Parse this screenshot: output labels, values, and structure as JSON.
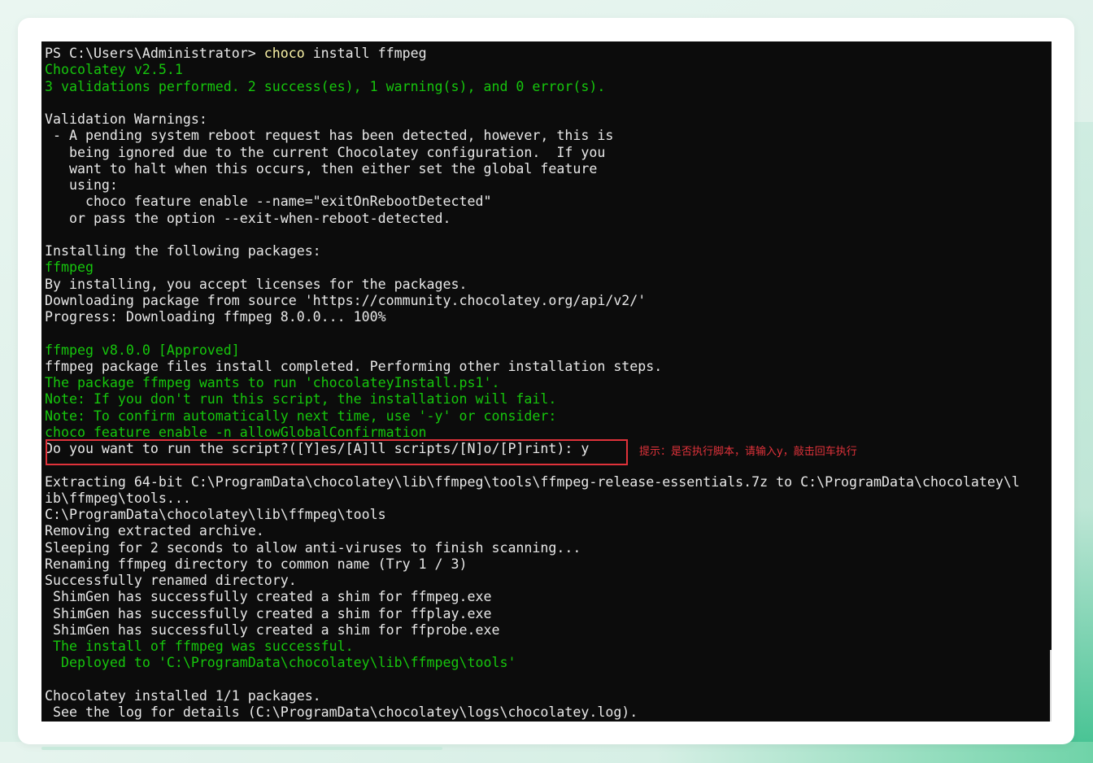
{
  "terminal": {
    "lines": [
      {
        "text": "PS C:\\Users\\Administrator> choco install ffmpeg",
        "color": "white"
      },
      {
        "text": "Chocolatey v2.5.1",
        "color": "green"
      },
      {
        "text": "3 validations performed. 2 success(es), 1 warning(s), and 0 error(s).",
        "color": "green"
      },
      {
        "text": "",
        "color": "white"
      },
      {
        "text": "Validation Warnings:",
        "color": "white"
      },
      {
        "text": " - A pending system reboot request has been detected, however, this is",
        "color": "white"
      },
      {
        "text": "   being ignored due to the current Chocolatey configuration.  If you",
        "color": "white"
      },
      {
        "text": "   want to halt when this occurs, then either set the global feature",
        "color": "white"
      },
      {
        "text": "   using:",
        "color": "white"
      },
      {
        "text": "     choco feature enable --name=\"exitOnRebootDetected\"",
        "color": "white"
      },
      {
        "text": "   or pass the option --exit-when-reboot-detected.",
        "color": "white"
      },
      {
        "text": "",
        "color": "white"
      },
      {
        "text": "Installing the following packages:",
        "color": "white"
      },
      {
        "text": "ffmpeg",
        "color": "green"
      },
      {
        "text": "By installing, you accept licenses for the packages.",
        "color": "white"
      },
      {
        "text": "Downloading package from source 'https://community.chocolatey.org/api/v2/'",
        "color": "white"
      },
      {
        "text": "Progress: Downloading ffmpeg 8.0.0... 100%",
        "color": "white"
      },
      {
        "text": "",
        "color": "white"
      },
      {
        "text": "ffmpeg v8.0.0 [Approved]",
        "color": "green"
      },
      {
        "text": "ffmpeg package files install completed. Performing other installation steps.",
        "color": "white"
      },
      {
        "text": "The package ffmpeg wants to run 'chocolateyInstall.ps1'.",
        "color": "green"
      },
      {
        "text": "Note: If you don't run this script, the installation will fail.",
        "color": "green"
      },
      {
        "text": "Note: To confirm automatically next time, use '-y' or consider:",
        "color": "green"
      },
      {
        "text": "choco feature enable -n allowGlobalConfirmation",
        "color": "green"
      },
      {
        "text": "Do you want to run the script?([Y]es/[A]ll scripts/[N]o/[P]rint): y",
        "color": "white"
      },
      {
        "text": "",
        "color": "white"
      },
      {
        "text": "Extracting 64-bit C:\\ProgramData\\chocolatey\\lib\\ffmpeg\\tools\\ffmpeg-release-essentials.7z to C:\\ProgramData\\chocolatey\\l",
        "color": "white"
      },
      {
        "text": "ib\\ffmpeg\\tools...",
        "color": "white"
      },
      {
        "text": "C:\\ProgramData\\chocolatey\\lib\\ffmpeg\\tools",
        "color": "white"
      },
      {
        "text": "Removing extracted archive.",
        "color": "white"
      },
      {
        "text": "Sleeping for 2 seconds to allow anti-viruses to finish scanning...",
        "color": "white"
      },
      {
        "text": "Renaming ffmpeg directory to common name (Try 1 / 3)",
        "color": "white"
      },
      {
        "text": "Successfully renamed directory.",
        "color": "white"
      },
      {
        "text": " ShimGen has successfully created a shim for ffmpeg.exe",
        "color": "white"
      },
      {
        "text": " ShimGen has successfully created a shim for ffplay.exe",
        "color": "white"
      },
      {
        "text": " ShimGen has successfully created a shim for ffprobe.exe",
        "color": "white"
      },
      {
        "text": " The install of ffmpeg was successful.",
        "color": "green"
      },
      {
        "text": "  Deployed to 'C:\\ProgramData\\chocolatey\\lib\\ffmpeg\\tools'",
        "color": "green"
      },
      {
        "text": "",
        "color": "white"
      },
      {
        "text": "Chocolatey installed 1/1 packages.",
        "color": "white"
      },
      {
        "text": " See the log for details (C:\\ProgramData\\chocolatey\\logs\\chocolatey.log).",
        "color": "white"
      }
    ],
    "command_segments": {
      "prompt": "PS C:\\Users\\Administrator> ",
      "command": "choco",
      "args": " install ffmpeg"
    }
  },
  "annotation": {
    "text": "提示：是否执行脚本，请输入y，敲击回车执行",
    "color": "#e0323a"
  },
  "colors": {
    "terminal_bg": "#0c0c0c",
    "text_white": "#e8e8e8",
    "text_green": "#16c60c",
    "text_yellow": "#f9f1a5",
    "highlight_box": "#e0323a"
  }
}
